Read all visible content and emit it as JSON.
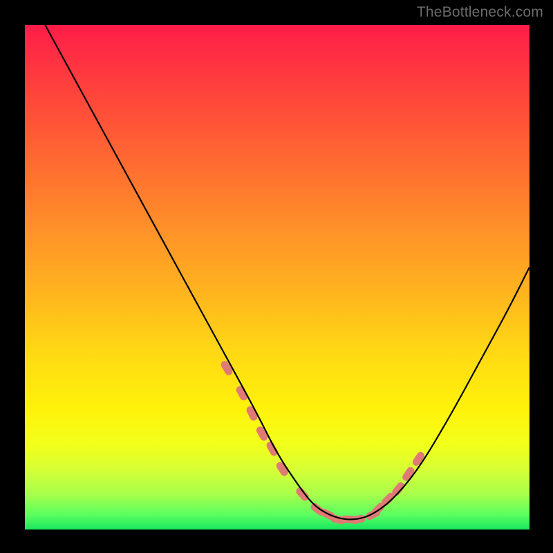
{
  "watermark": {
    "text": "TheBottleneck.com"
  },
  "chart_data": {
    "type": "line",
    "title": "",
    "xlabel": "",
    "ylabel": "",
    "xlim": [
      0,
      100
    ],
    "ylim": [
      0,
      100
    ],
    "curve": {
      "name": "bottleneck-curve",
      "color": "#000000",
      "x": [
        4,
        10,
        16,
        22,
        28,
        34,
        40,
        46,
        50,
        54,
        57,
        60,
        63,
        66,
        69,
        73,
        78,
        84,
        90,
        96,
        100
      ],
      "y": [
        100,
        89,
        78,
        67,
        56,
        45,
        34,
        23,
        15,
        9,
        5,
        3,
        2,
        2,
        3,
        6,
        12,
        22,
        33,
        44,
        52
      ]
    },
    "highlight_points": {
      "color": "#e07a74",
      "x": [
        40,
        43,
        45,
        47,
        49,
        51,
        55,
        58,
        60,
        62,
        64,
        66,
        69,
        70,
        72,
        74,
        76,
        78
      ],
      "y": [
        32,
        27,
        23,
        19,
        16,
        12,
        7,
        4,
        3,
        2,
        2,
        2,
        3,
        4,
        6,
        8,
        11,
        14
      ]
    }
  }
}
